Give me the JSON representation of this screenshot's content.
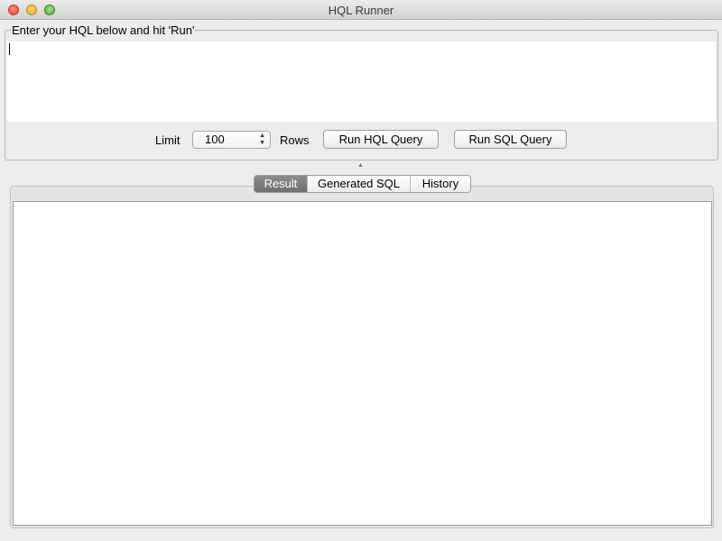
{
  "window": {
    "title": "HQL Runner"
  },
  "query_panel": {
    "legend": "Enter your HQL below and hit 'Run'",
    "editor_value": "",
    "limit_label": "Limit",
    "limit_value": "100",
    "rows_label": "Rows",
    "run_hql_label": "Run HQL Query",
    "run_sql_label": "Run SQL Query"
  },
  "tabs": [
    {
      "label": "Result",
      "active": true
    },
    {
      "label": "Generated SQL",
      "active": false
    },
    {
      "label": "History",
      "active": false
    }
  ],
  "icons": {
    "close": "close-icon",
    "minimize": "minimize-icon",
    "maximize": "maximize-icon",
    "spinner": "spinner-arrows-icon",
    "split": "split-handle-icon"
  }
}
